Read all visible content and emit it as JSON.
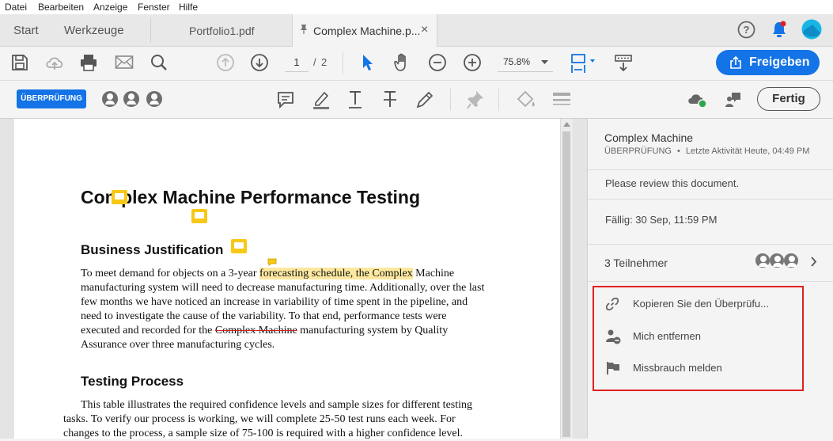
{
  "menubar": {
    "items": [
      "Datei",
      "Bearbeiten",
      "Anzeige",
      "Fenster",
      "Hilfe"
    ]
  },
  "tabs": {
    "start": "Start",
    "werkzeuge": "Werkzeuge",
    "portfolio": "Portfolio1.pdf",
    "active": "Complex Machine.p...",
    "close": "×"
  },
  "toolbar": {
    "page_current": "1",
    "page_sep": "/",
    "page_total": "2",
    "zoom": "75.8%",
    "share_label": "Freigeben"
  },
  "review_bar": {
    "badge": "ÜBERPRÜFUNG",
    "done_label": "Fertig"
  },
  "document": {
    "title": "Complex Machine Performance Testing",
    "h_business": "Business Justification",
    "para1": [
      {
        "pre": "To meet demand for objects on a 3-year ",
        "hl": "forecasting schedule, the Complex",
        "post": " Machine"
      },
      "manufacturing system will need to decrease manufacturing time. Additionally, over the last",
      "few months we have noticed an increase in variability of time spent in the pipeline, and",
      "need to investigate the cause of the variability. To that end, performance tests were",
      {
        "pre": "executed and recorded for the ",
        "strike": "Complex Machine",
        "post": " manufacturing system by Quality"
      },
      "Assurance over three manufacturing cycles."
    ],
    "h_testing": "Testing Process",
    "para2": [
      "This table illustrates the required confidence levels and sample sizes for different testing",
      "tasks. To verify our process is working, we will complete 25-50 test runs each week. For",
      "changes to the process, a sample size of 75-100 is required with a higher confidence level."
    ]
  },
  "review_panel": {
    "doc_title": "Complex Machine",
    "status": "ÜBERPRÜFUNG",
    "bullet": "•",
    "last_activity": "Letzte Aktivität Heute, 04:49 PM",
    "message": "Please review this document.",
    "due": "Fällig: 30 Sep, 11:59 PM",
    "participants": "3 Teilnehmer",
    "menu": {
      "copy_link": "Kopieren Sie den Überprüfu...",
      "remove_me": "Mich entfernen",
      "report_abuse": "Missbrauch melden"
    }
  },
  "colors": {
    "accent": "#1473e6",
    "highlight_frame": "#e02020",
    "note": "#f7c815",
    "text_highlight": "#fde8a0"
  }
}
